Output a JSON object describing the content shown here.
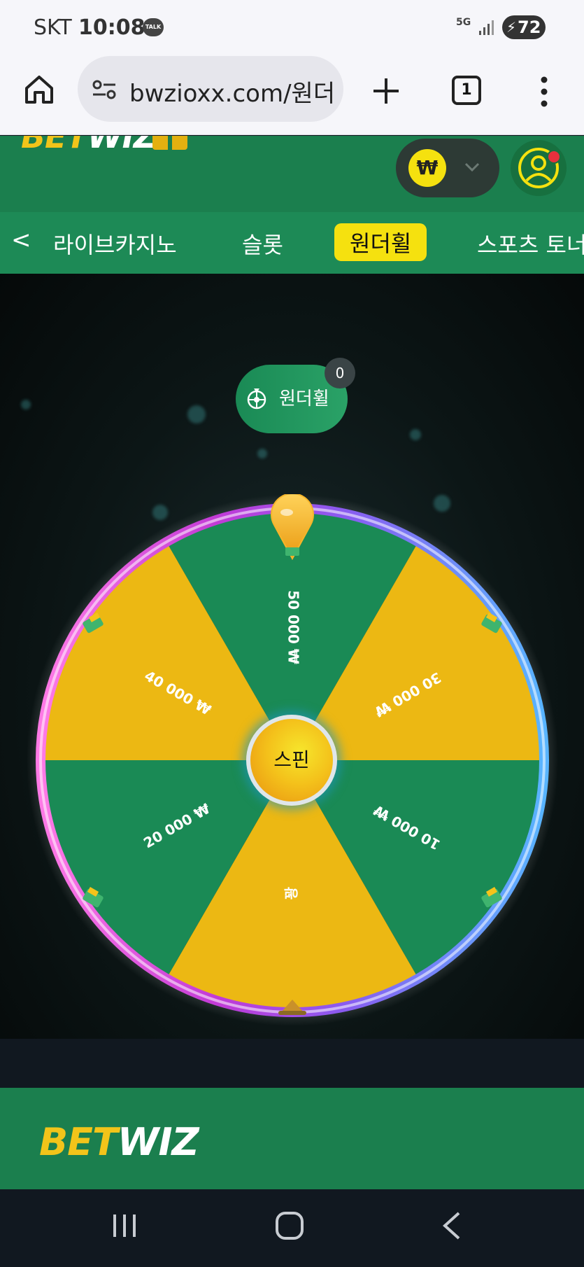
{
  "status_bar": {
    "carrier": "SKT",
    "time": "10:08",
    "talk": "TALK",
    "network": "5G",
    "battery": "72"
  },
  "browser": {
    "url": "bwzioxx.com/원더",
    "tab_count": "1"
  },
  "header": {
    "logo_bet": "BET",
    "logo_wiz": "WIZ",
    "currency_symbol": "₩"
  },
  "nav": {
    "back": "<",
    "items": [
      "라이브카지노",
      "슬롯",
      "원더휠",
      "스포츠 토너"
    ],
    "active_index": 2
  },
  "game": {
    "pill_label": "원더휠",
    "pill_count": "0",
    "spin_label": "스핀",
    "segments": [
      {
        "label": "50 000 ₩",
        "color": "#1a8a55"
      },
      {
        "label": "30 000 ₩",
        "color": "#ecb813"
      },
      {
        "label": "10 000 ₩",
        "color": "#1a8a55"
      },
      {
        "label": "꽝",
        "color": "#ecb813"
      },
      {
        "label": "20 000 ₩",
        "color": "#1a8a55"
      },
      {
        "label": "40 000 ₩",
        "color": "#ecb813"
      }
    ]
  },
  "footer": {
    "logo_bet": "BET",
    "logo_wiz": "WIZ"
  },
  "colors": {
    "brand_green": "#1b7f4e",
    "brand_yellow": "#f5e10f",
    "segment_green": "#1a8a55",
    "segment_yellow": "#ecb813"
  }
}
